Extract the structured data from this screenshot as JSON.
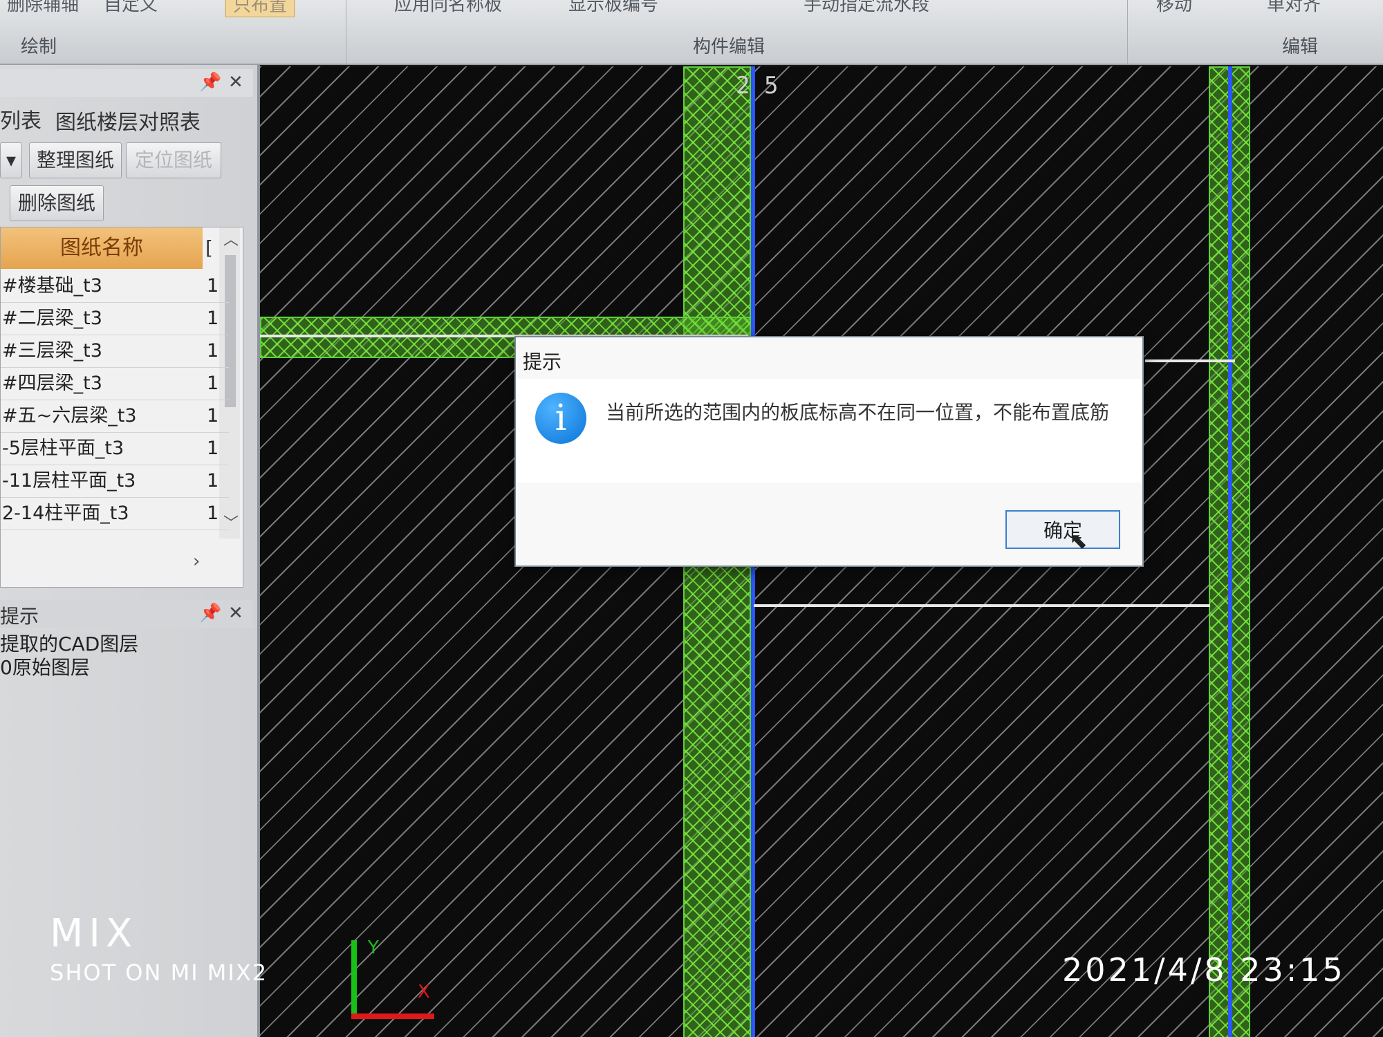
{
  "ribbon": {
    "cmd_delete_edit": "删除辅轴",
    "cmd_custom": "自定义",
    "cmd_highlight": "只布置",
    "cmd_apply": "应用同名称板",
    "cmd_show_id": "显示板编号",
    "cmd_manual": "手动指定流水段",
    "cmd_move": "移动",
    "cmd_align": "单对齐",
    "group_draw": "绘制",
    "group_component_edit": "构件编辑",
    "group_edit": "编辑"
  },
  "drawing_panel": {
    "tab_list": "列表",
    "tab_floor_map": "图纸楼层对照表",
    "btn_organize": "整理图纸",
    "btn_locate": "定位图纸",
    "btn_delete": "删除图纸",
    "column_name": "图纸名称",
    "column_num": "[",
    "rows": [
      {
        "name": "#楼基础_t3",
        "num": "1"
      },
      {
        "name": "#二层梁_t3",
        "num": "1"
      },
      {
        "name": "#三层梁_t3",
        "num": "1"
      },
      {
        "name": "#四层梁_t3",
        "num": "1"
      },
      {
        "name": "#五~六层梁_t3",
        "num": "1"
      },
      {
        "name": "-5层柱平面_t3",
        "num": "1"
      },
      {
        "name": "-11层柱平面_t3",
        "num": "1"
      },
      {
        "name": "2-14柱平面_t3",
        "num": "1"
      }
    ]
  },
  "hint_panel": {
    "title": "提示",
    "line1": "提取的CAD图层",
    "line2": "0原始图层"
  },
  "canvas": {
    "axis_label": "2 5",
    "ucs_y": "Y",
    "ucs_x": "X",
    "colors": {
      "beam_green": "#5fd23a",
      "axis_blue": "#2a55ff",
      "hatch": "#d2d2d2"
    }
  },
  "dialog": {
    "title": "提示",
    "message": "当前所选的范围内的板底标高不在同一位置，不能布置底筋",
    "ok_label": "确定",
    "icon": "info-icon"
  },
  "watermark": {
    "logo": "MIX",
    "shot_on": "SHOT ON MI MIX2",
    "datetime": "2021/4/8  23:15"
  }
}
